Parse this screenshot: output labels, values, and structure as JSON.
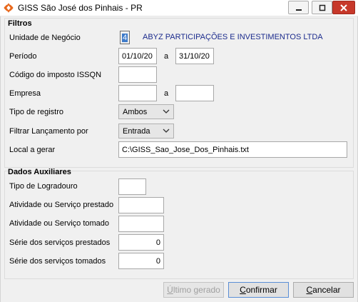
{
  "window": {
    "title": "GISS São José dos Pinhais - PR",
    "app_icon": "app-logo-icon"
  },
  "filtros": {
    "title": "Filtros",
    "unidade_label": "Unidade de Negócio",
    "unidade_code": "4",
    "unidade_name": "ABYZ PARTICIPAÇÕES E INVESTIMENTOS LTDA",
    "periodo_label": "Período",
    "periodo_from": "01/10/20",
    "periodo_sep": "a",
    "periodo_to": "31/10/20",
    "codigo_label": "Código do imposto ISSQN",
    "codigo_value": "",
    "empresa_label": "Empresa",
    "empresa_from": "",
    "empresa_sep": "a",
    "empresa_to": "",
    "tipo_label": "Tipo de registro",
    "tipo_value": "Ambos",
    "filtrar_label": "Filtrar Lançamento por",
    "filtrar_value": "Entrada",
    "local_label": "Local a gerar",
    "local_value": "C:\\GISS_Sao_Jose_Dos_Pinhais.txt"
  },
  "auxiliares": {
    "title": "Dados Auxiliares",
    "logradouro_label": "Tipo de Logradouro",
    "logradouro_value": "",
    "prestado_label": "Atividade ou Serviço prestado",
    "prestado_value": "",
    "tomado_label": "Atividade ou Serviço tomado",
    "tomado_value": "",
    "serie_prest_label": "Série dos serviços prestados",
    "serie_prest_value": "0",
    "serie_tom_label": "Série dos serviços tomados",
    "serie_tom_value": "0"
  },
  "buttons": {
    "ultimo_first": "Ú",
    "ultimo_rest": "ltimo gerado",
    "confirmar_first": "C",
    "confirmar_rest": "onfirmar",
    "cancelar_first": "C",
    "cancelar_rest": "ancelar"
  },
  "colors": {
    "close_button": "#c7382a",
    "selection": "#3d7ac9",
    "company_name": "#1a2a8c"
  }
}
